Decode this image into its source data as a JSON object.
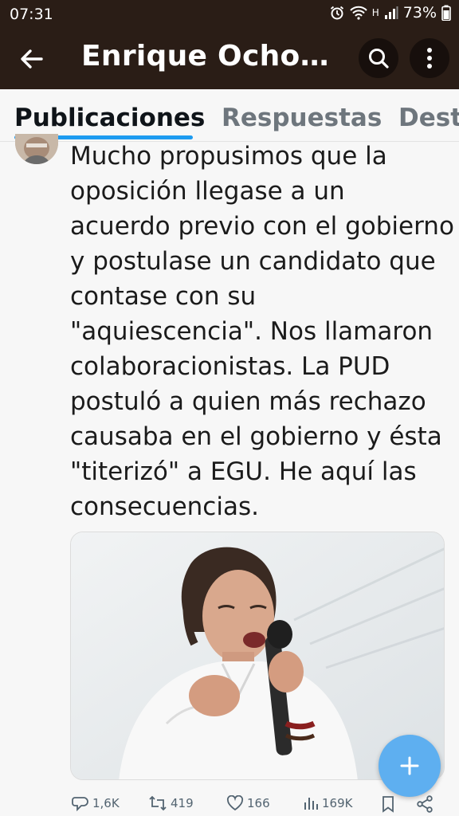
{
  "status_bar": {
    "time": "07:31",
    "network_label": "H",
    "battery": "73%"
  },
  "header": {
    "title": "Enrique Ocho…",
    "back_icon": "arrow-left-icon",
    "search_icon": "search-icon",
    "more_icon": "more-vertical-icon"
  },
  "tabs": [
    {
      "label": "Publicaciones",
      "active": true
    },
    {
      "label": "Respuestas",
      "active": false
    },
    {
      "label": "Dest",
      "active": false
    }
  ],
  "tweet": {
    "text_lines": [
      "Mucho propusimos que la",
      "oposición llegase a un",
      "acuerdo previo con el gobierno",
      "y postulase un candidato que",
      "contase con su",
      "\"aquiescencia\". Nos llamaron",
      "colaboracionistas. La PUD",
      "postuló a quien más rechazo",
      "causaba en el gobierno y ésta",
      "\"titerizó\" a EGU. He aquí las",
      "consecuencias."
    ]
  },
  "actions": {
    "replies": "1,6K",
    "retweets": "419",
    "likes": "166",
    "views": "169K"
  },
  "colors": {
    "accent": "#1d9bf0",
    "fab": "#5eaff0",
    "header_bg": "#2a1d16"
  }
}
